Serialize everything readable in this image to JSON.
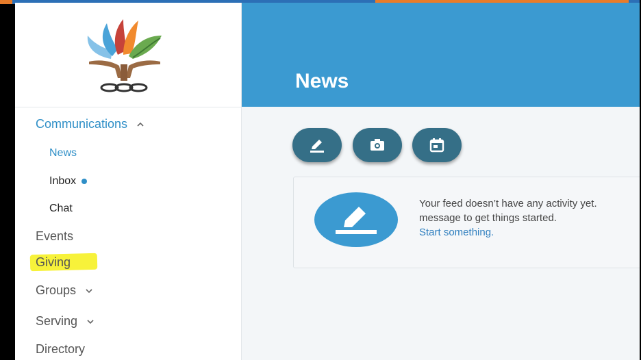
{
  "nav": {
    "communications": "Communications",
    "news": "News",
    "inbox": "Inbox",
    "chat": "Chat",
    "events": "Events",
    "giving": "Giving",
    "groups": "Groups",
    "serving": "Serving",
    "directory": "Directory"
  },
  "header": {
    "title": "News"
  },
  "actions": [
    {
      "icon": "pencil-icon"
    },
    {
      "icon": "camera-icon"
    },
    {
      "icon": "calendar-icon"
    }
  ],
  "empty_state": {
    "line1": "Your feed doesn’t have any activity yet.",
    "line2": "message to get things started.",
    "link": "Start something."
  },
  "colors": {
    "header_blue": "#3b9ad1",
    "action_teal": "#356f87",
    "link_blue": "#2f7fbf",
    "highlight_yellow": "#f7f23a"
  }
}
